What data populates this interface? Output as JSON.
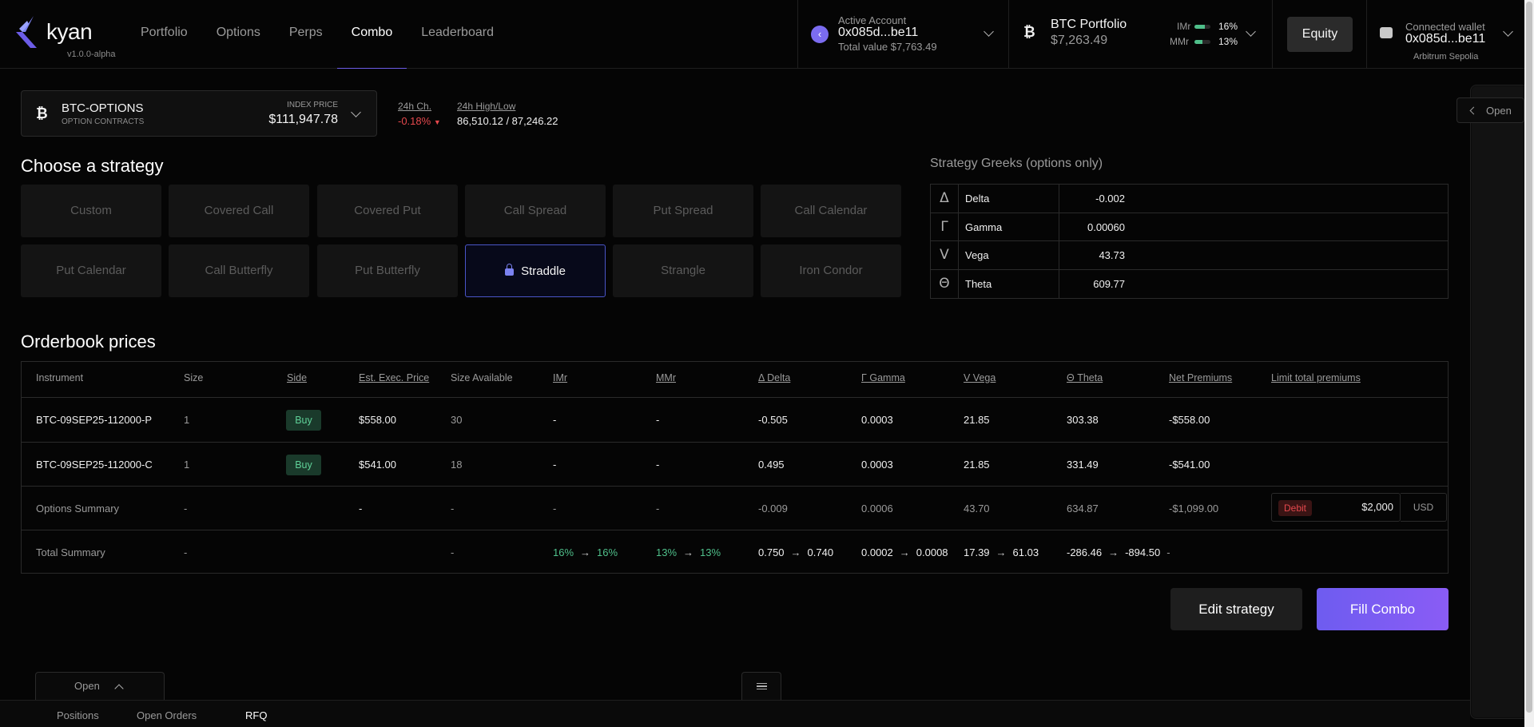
{
  "header": {
    "logo_text": "kyan",
    "version": "v1.0.0-alpha",
    "nav": [
      {
        "label": "Portfolio",
        "active": false
      },
      {
        "label": "Options",
        "active": false
      },
      {
        "label": "Perps",
        "active": false
      },
      {
        "label": "Combo",
        "active": true
      },
      {
        "label": "Leaderboard",
        "active": false
      }
    ],
    "account": {
      "label": "Active Account",
      "address": "0x085d...be11",
      "total": "Total value $7,763.49"
    },
    "portfolio": {
      "name": "BTC Portfolio",
      "value": "$7,263.49",
      "imr_label": "IMr",
      "imr_value": "16%",
      "imr_fill": 0.16,
      "mmr_label": "MMr",
      "mmr_value": "13%",
      "mmr_fill": 0.13
    },
    "equity_label": "Equity",
    "wallet": {
      "label": "Connected wallet",
      "address": "0x085d...be11",
      "network": "Arbitrum Sepolia"
    }
  },
  "instrument": {
    "name": "BTC-OPTIONS",
    "subtitle": "OPTION CONTRACTS",
    "index_label": "INDEX PRICE",
    "index_price": "$111,947.78",
    "change_label": "24h Ch.",
    "change_value": "-0.18%",
    "hl_label": "24h High/Low",
    "hl_value": "86,510.12 / 87,246.22"
  },
  "strategy": {
    "title": "Choose a strategy",
    "options": [
      {
        "label": "Custom",
        "active": false
      },
      {
        "label": "Covered Call",
        "active": false
      },
      {
        "label": "Covered Put",
        "active": false
      },
      {
        "label": "Call Spread",
        "active": false
      },
      {
        "label": "Put Spread",
        "active": false
      },
      {
        "label": "Call Calendar",
        "active": false
      },
      {
        "label": "Put Calendar",
        "active": false
      },
      {
        "label": "Call Butterfly",
        "active": false
      },
      {
        "label": "Put Butterfly",
        "active": false
      },
      {
        "label": "Straddle",
        "active": true
      },
      {
        "label": "Strangle",
        "active": false
      },
      {
        "label": "Iron Condor",
        "active": false
      }
    ]
  },
  "greeks": {
    "title": "Strategy Greeks (options only)",
    "rows": [
      {
        "symbol": "Δ",
        "name": "Delta",
        "value": "-0.002"
      },
      {
        "symbol": "Γ",
        "name": "Gamma",
        "value": "0.00060"
      },
      {
        "symbol": "V",
        "name": "Vega",
        "value": "43.73"
      },
      {
        "symbol": "Θ",
        "name": "Theta",
        "value": "609.77"
      }
    ]
  },
  "orderbook": {
    "title": "Orderbook prices",
    "headers": {
      "instrument": "Instrument",
      "size": "Size",
      "side": "Side",
      "est_price": "Est. Exec. Price",
      "size_available": "Size Available",
      "imr": "IMr",
      "mmr": "MMr",
      "delta": "Δ Delta",
      "gamma": "Γ Gamma",
      "vega": "V Vega",
      "theta": "Θ Theta",
      "net_premiums": "Net Premiums",
      "limit": "Limit total premiums"
    },
    "legs": [
      {
        "instrument": "BTC-09SEP25-112000-P",
        "size": "1",
        "side": "Buy",
        "price": "$558.00",
        "available": "30",
        "imr": "-",
        "mmr": "-",
        "delta": "-0.505",
        "gamma": "0.0003",
        "vega": "21.85",
        "theta": "303.38",
        "net": "-$558.00"
      },
      {
        "instrument": "BTC-09SEP25-112000-C",
        "size": "1",
        "side": "Buy",
        "price": "$541.00",
        "available": "18",
        "imr": "-",
        "mmr": "-",
        "delta": "0.495",
        "gamma": "0.0003",
        "vega": "21.85",
        "theta": "331.49",
        "net": "-$541.00"
      }
    ],
    "options_summary": {
      "label": "Options Summary",
      "size": "-",
      "price": "-",
      "available": "-",
      "imr": "-",
      "mmr": "-",
      "delta": "-0.009",
      "gamma": "0.0006",
      "vega": "43.70",
      "theta": "634.87",
      "net": "-$1,099.00",
      "limit_type": "Debit",
      "limit_value": "$2,000",
      "limit_currency": "USD"
    },
    "total_summary": {
      "label": "Total Summary",
      "size": "-",
      "available": "-",
      "imr_from": "16%",
      "imr_to": "16%",
      "mmr_from": "13%",
      "mmr_to": "13%",
      "delta_from": "0.750",
      "delta_to": "0.740",
      "gamma_from": "0.0002",
      "gamma_to": "0.0008",
      "vega_from": "17.39",
      "vega_to": "61.03",
      "theta_from": "-286.46",
      "theta_to": "-894.50",
      "net": "-",
      "arrow": "→"
    }
  },
  "actions": {
    "edit": "Edit strategy",
    "fill": "Fill Combo"
  },
  "bottom": {
    "open_label": "Open",
    "tabs": [
      {
        "label": "Positions",
        "active": false
      },
      {
        "label": "Open Orders",
        "active": false
      },
      {
        "label": "RFQ",
        "active": true
      }
    ]
  },
  "side_panel": {
    "open_label": "Open"
  },
  "colors": {
    "accent": "#6e5cf0",
    "positive": "#4fbf8a",
    "negative": "#e5484d"
  }
}
